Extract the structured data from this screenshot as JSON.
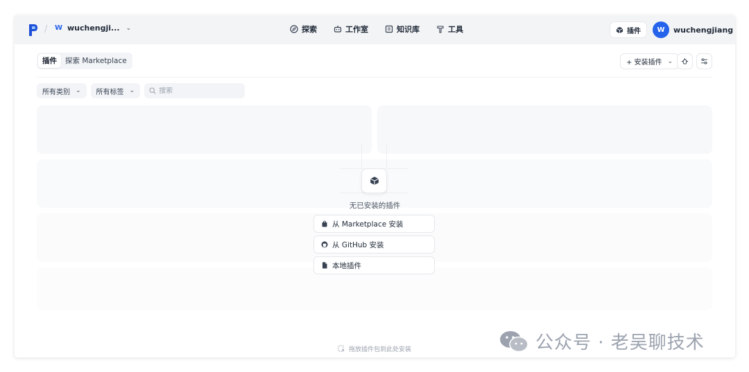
{
  "topbar": {
    "workspace_badge": "W",
    "workspace_name": "wuchengji...",
    "nav": [
      {
        "label": "探索",
        "icon": "compass-icon"
      },
      {
        "label": "工作室",
        "icon": "robot-icon"
      },
      {
        "label": "知识库",
        "icon": "book-icon"
      },
      {
        "label": "工具",
        "icon": "hammer-icon"
      }
    ],
    "plugins_label": "插件",
    "user_initial": "W",
    "user_name": "wuchengjiang"
  },
  "main": {
    "tabs": [
      {
        "label": "插件",
        "active": true
      },
      {
        "label": "探索 Marketplace",
        "active": false
      }
    ],
    "install_button": "+ 安装插件",
    "filters": {
      "category": "所有类别",
      "tags": "所有标签",
      "search_placeholder": "搜索"
    },
    "empty": {
      "message": "无已安装的插件",
      "options": [
        {
          "label": "从 Marketplace 安装",
          "icon": "marketplace-icon"
        },
        {
          "label": "从 GitHub 安装",
          "icon": "github-icon"
        },
        {
          "label": "本地插件",
          "icon": "file-icon"
        }
      ]
    },
    "drop_hint": "拖放插件包到此处安装"
  },
  "watermark": "公众号 · 老吴聊技术",
  "colors": {
    "accent": "#2563eb",
    "panel_bg": "#ffffff",
    "frame_bg": "#f3f4f6"
  }
}
